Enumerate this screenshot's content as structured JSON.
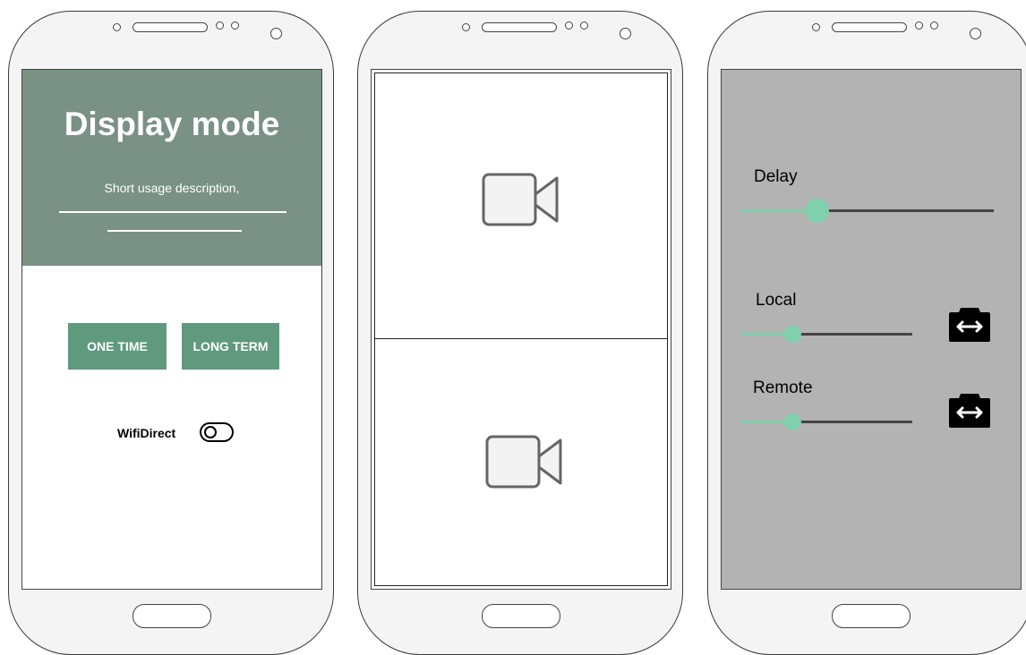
{
  "phones": {
    "mode": {
      "title": "Display mode",
      "description": "Short usage description,",
      "buttons": {
        "one_time": "ONE TIME",
        "long_term": "LONG TERM"
      },
      "wifi_direct": {
        "label": "WifiDirect",
        "enabled": false
      }
    },
    "video": {
      "panes": [
        {
          "icon": "video-camera-icon"
        },
        {
          "icon": "video-camera-icon"
        }
      ]
    },
    "settings": {
      "sliders": {
        "delay": {
          "label": "Delay",
          "value_fraction": 0.3
        },
        "local": {
          "label": "Local",
          "value_fraction": 0.3
        },
        "remote": {
          "label": "Remote",
          "value_fraction": 0.3
        }
      },
      "switch_icon": "switch-camera-icon"
    }
  },
  "colors": {
    "header_bg": "#7a9185",
    "button_bg": "#5f9a7e",
    "slider_accent": "#7fd0ad",
    "settings_bg": "#b3b3b3"
  }
}
